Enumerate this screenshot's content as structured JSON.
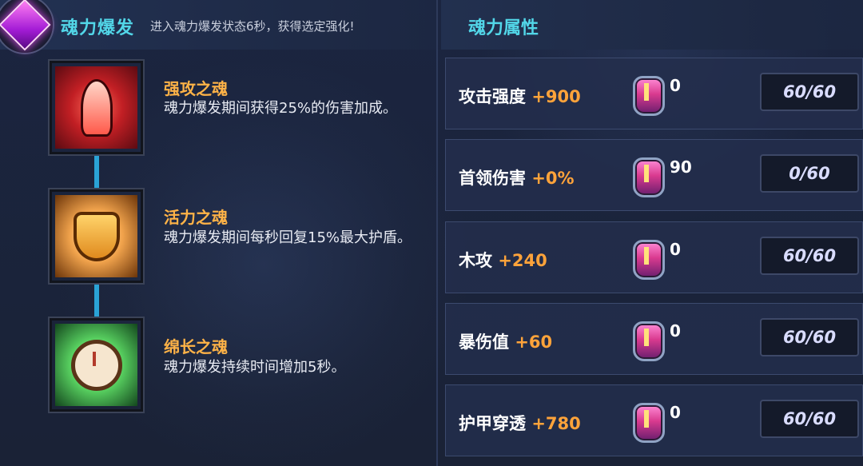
{
  "panel_left": {
    "title": "魂力爆发",
    "description": "进入魂力爆发状态6秒，获得选定强化!",
    "skills": [
      {
        "name": "强攻之魂",
        "desc": "魂力爆发期间获得25%的伤害加成。",
        "icon": "flame-icon"
      },
      {
        "name": "活力之魂",
        "desc": "魂力爆发期间每秒回复15%最大护盾。",
        "icon": "shield-icon"
      },
      {
        "name": "绵长之魂",
        "desc": "魂力爆发持续时间增加5秒。",
        "icon": "clock-icon"
      }
    ]
  },
  "panel_right": {
    "title": "魂力属性",
    "attributes": [
      {
        "label": "攻击强度",
        "bonus": "+900",
        "gem_count": "0",
        "progress": "60/60"
      },
      {
        "label": "首领伤害",
        "bonus": "+0%",
        "gem_count": "90",
        "progress": "0/60"
      },
      {
        "label": "木攻",
        "bonus": "+240",
        "gem_count": "0",
        "progress": "60/60"
      },
      {
        "label": "暴伤值",
        "bonus": "+60",
        "gem_count": "0",
        "progress": "60/60"
      },
      {
        "label": "护甲穿透",
        "bonus": "+780",
        "gem_count": "0",
        "progress": "60/60"
      }
    ]
  },
  "colors": {
    "accent_title": "#52d6e8",
    "skill_name": "#ffb347",
    "bonus": "#ffa33a",
    "connector": "#2aa3d6"
  }
}
